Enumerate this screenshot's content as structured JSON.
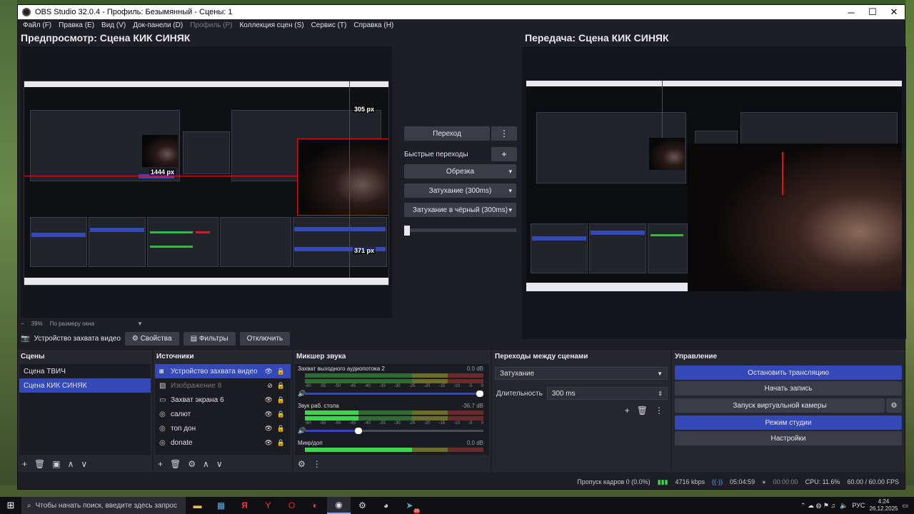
{
  "window": {
    "title": "OBS Studio 32.0.4 - Профиль: Безымянный - Сцены: 1",
    "controls": [
      "─",
      "☐",
      "✕"
    ]
  },
  "menu": [
    {
      "label": "Файл (F)",
      "enabled": true
    },
    {
      "label": "Правка (E)",
      "enabled": true
    },
    {
      "label": "Вид (V)",
      "enabled": true
    },
    {
      "label": "Док-панели (D)",
      "enabled": true
    },
    {
      "label": "Профиль (P)",
      "enabled": false
    },
    {
      "label": "Коллекция сцен (S)",
      "enabled": true
    },
    {
      "label": "Сервис (T)",
      "enabled": true
    },
    {
      "label": "Справка (H)",
      "enabled": true
    }
  ],
  "preview": {
    "title": "Предпросмотр: Сцена КИК СИНЯК",
    "measure_top": "305 px",
    "measure_left": "1444 px",
    "measure_bottom": "371 px",
    "zoom_minus": "−",
    "zoom_value": "39%",
    "zoom_mode": "По размеру окна"
  },
  "program": {
    "title": "Передача: Сцена КИК СИНЯК"
  },
  "transition_panel": {
    "transition_button": "Переход",
    "quick_transitions_label": "Быстрые переходы",
    "items": [
      "Обрезка",
      "Затухание (300ms)",
      "Затухание в чёрный (300ms)"
    ],
    "more_glyph": "⋮",
    "add_glyph": "+"
  },
  "source_toolbar": {
    "current_source": "Устройство захвата видео",
    "properties": "Свойства",
    "filters": "Фильтры",
    "deactivate": "Отключить"
  },
  "scenes": {
    "title": "Сцены",
    "items": [
      {
        "label": "Сцена ТВИЧ",
        "selected": false
      },
      {
        "label": "Сцена КИК СИНЯК",
        "selected": true
      }
    ]
  },
  "sources": {
    "title": "Источники",
    "items": [
      {
        "label": "Устройство захвата видео",
        "icon": "camera-icon",
        "selected": true,
        "dim": false
      },
      {
        "label": "Изображение 8",
        "icon": "image-icon",
        "selected": false,
        "dim": true
      },
      {
        "label": "Захват экрана 6",
        "icon": "monitor-icon",
        "selected": false,
        "dim": false
      },
      {
        "label": "салют",
        "icon": "globe-icon",
        "selected": false,
        "dim": false
      },
      {
        "label": "топ дон",
        "icon": "globe-icon",
        "selected": false,
        "dim": false
      },
      {
        "label": "donate",
        "icon": "globe-icon",
        "selected": false,
        "dim": false
      }
    ]
  },
  "mixer": {
    "title": "Микшер звука",
    "ticks": [
      "-60",
      "-55",
      "-50",
      "-45",
      "-40",
      "-35",
      "-30",
      "-25",
      "-20",
      "-15",
      "-10",
      "-5",
      "0"
    ],
    "channels": [
      {
        "name": "Захват выходного аудиопотока 2",
        "db": "0.0 dB",
        "level": 0.0,
        "volume": 1.0
      },
      {
        "name": "Звук раб. стола",
        "db": "-36.7 dB",
        "level": 0.3,
        "volume": 0.32
      },
      {
        "name": "Микр/доп",
        "db": "0.0 dB",
        "level": 0.6,
        "volume": 1.0
      }
    ]
  },
  "transitions": {
    "title": "Переходы между сценами",
    "selected": "Затухание",
    "duration_label": "Длительность",
    "duration_value": "300 ms"
  },
  "controls": {
    "title": "Управление",
    "stop_stream": "Остановить трансляцию",
    "start_record": "Начать запись",
    "virtual_cam": "Запуск виртуальной камеры",
    "studio_mode": "Режим студии",
    "settings": "Настройки"
  },
  "status": {
    "dropped_frames": "Пропуск кадров 0 (0.0%)",
    "bitrate": "4716 kbps",
    "stream_time": "05:04:59",
    "record_time": "00:00:00",
    "cpu": "CPU: 11.6%",
    "fps": "60.00 / 60.00 FPS"
  },
  "taskbar": {
    "search_placeholder": "Чтобы начать поиск, введите здесь запрос",
    "lang": "РУС",
    "time": "4:24",
    "date": "26.12.2025",
    "badge": "20"
  },
  "colors": {
    "accent": "#3448b8",
    "window_bg": "#1e1f26",
    "meter_green": "#3bd94a",
    "meter_yellow": "#e8d23a",
    "meter_red": "#e04040"
  }
}
